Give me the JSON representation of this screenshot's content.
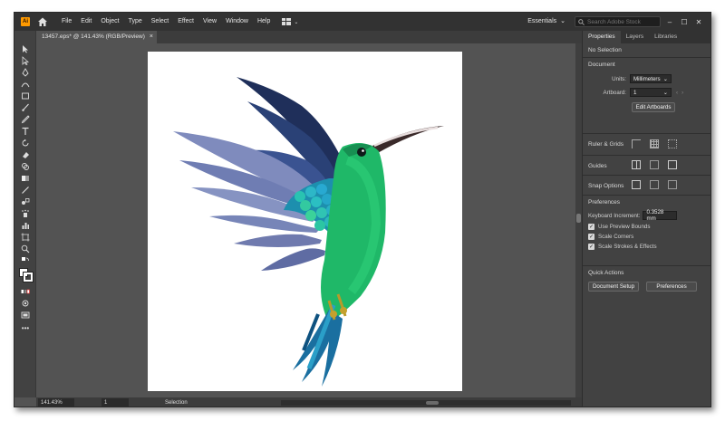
{
  "app": {
    "logo_text": "Ai"
  },
  "menu": [
    "File",
    "Edit",
    "Object",
    "Type",
    "Select",
    "Effect",
    "View",
    "Window",
    "Help"
  ],
  "workspace": {
    "label": "Essentials",
    "search_placeholder": "Search Adobe Stock"
  },
  "document_tab": {
    "title": "13457.eps* @ 141.43% (RGB/Preview)"
  },
  "status": {
    "zoom": "141.43%",
    "artboard_num": "1",
    "tool": "Selection"
  },
  "panel": {
    "tabs": [
      "Properties",
      "Layers",
      "Libraries"
    ],
    "selection": "No Selection",
    "document": {
      "title": "Document",
      "units_label": "Units:",
      "units_value": "Millimeters",
      "artboard_label": "Artboard:",
      "artboard_value": "1",
      "edit_button": "Edit Artboards"
    },
    "rulers_title": "Ruler & Grids",
    "guides_title": "Guides",
    "snap_title": "Snap Options",
    "preferences": {
      "title": "Preferences",
      "keyboard_label": "Keyboard Increment:",
      "keyboard_value": "0.3528 mm",
      "use_preview_bounds": "Use Preview Bounds",
      "scale_corners": "Scale Corners",
      "scale_strokes": "Scale Strokes & Effects"
    },
    "quick_actions": {
      "title": "Quick Actions",
      "doc_setup": "Document Setup",
      "preferences": "Preferences"
    }
  },
  "colors": {
    "accent_logo": "#ff9a00",
    "bird_body": "#1fb868",
    "wing_dark": "#1f2f5a",
    "wing_light": "#7f8bbd",
    "tail": "#1a6fa0"
  }
}
